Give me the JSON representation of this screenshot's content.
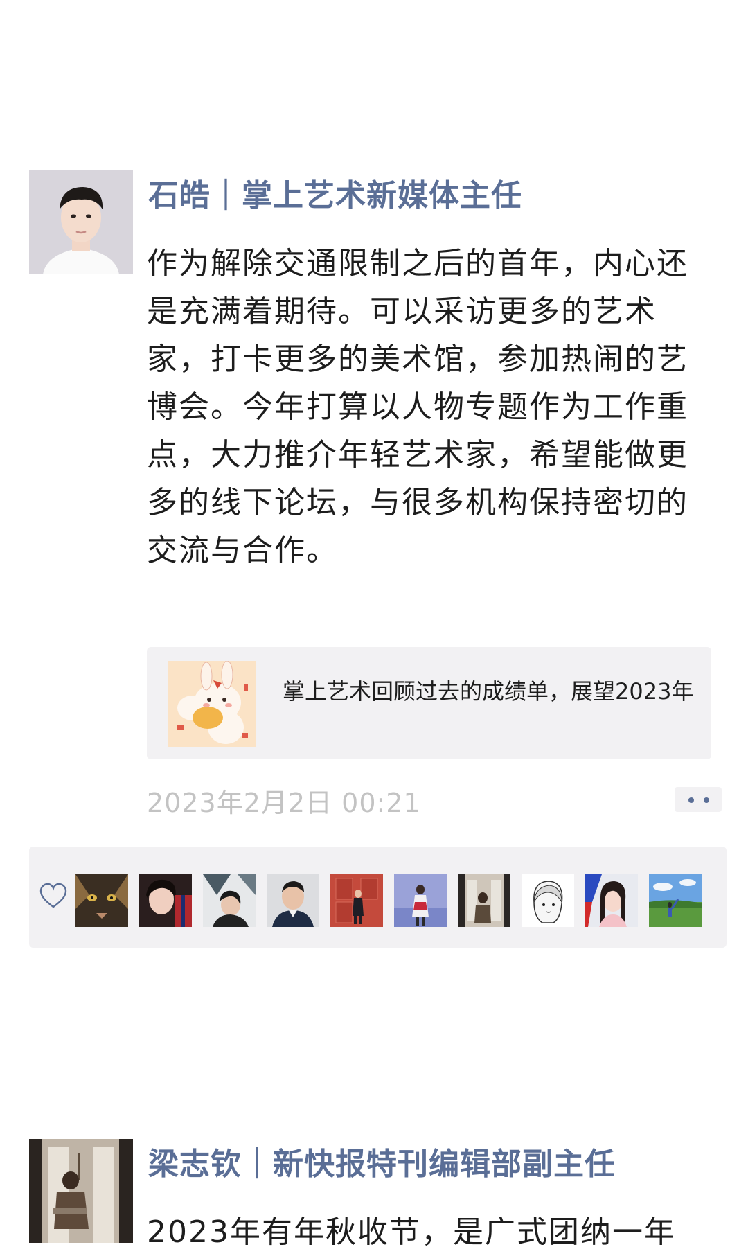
{
  "posts": [
    {
      "author": "石皓｜掌上艺术新媒体主任",
      "content": "作为解除交通限制之后的首年，内心还是充满着期待。可以采访更多的艺术家，打卡更多的美术馆，参加热闹的艺博会。今年打算以人物专题作为工作重点，大力推介年轻艺术家，希望能做更多的线下论坛，与很多机构保持密切的交流与合作。",
      "link_card": {
        "title": "掌上艺术回顾过去的成绩单，展望2023年"
      },
      "timestamp": "2023年2月2日 00:21"
    },
    {
      "author": "梁志钦｜新快报特刊编辑部副主任",
      "content": "2023年有年秋收节，是广式团纳一年"
    }
  ],
  "likes": {
    "icon": "heart-outline-icon",
    "avatar_count": 10
  },
  "colors": {
    "author_name": "#5a6e96",
    "panel_bg": "#f2f1f3",
    "timestamp": "#c3c3c3"
  }
}
